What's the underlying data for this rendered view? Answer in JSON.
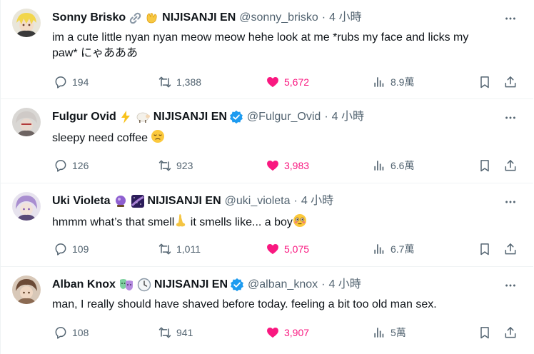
{
  "tweets": [
    {
      "name": "Sonny Brisko",
      "badge_icons": [
        "link-icon",
        "clap-hands-icon"
      ],
      "affiliation": "NIJISANJI EN",
      "handle": "@sonny_brisko",
      "time": "4 小時",
      "text_line1": "im a cute little nyan nyan meow meow hehe look at me *rubs my face and licks my",
      "text_line2": "paw*  にゃあああ",
      "replies": "194",
      "reposts": "1,388",
      "likes": "5,672",
      "views": "8.9萬",
      "verified": false
    },
    {
      "name": "Fulgur Ovid",
      "badge_icons": [
        "lightning-icon",
        "sheep-icon"
      ],
      "affiliation": "NIJISANJI EN",
      "handle": "@Fulgur_Ovid",
      "time": "4 小時",
      "text": "sleepy need coffee",
      "trailing_emoji": "pensive-face-icon",
      "replies": "126",
      "reposts": "923",
      "likes": "3,983",
      "views": "6.6萬",
      "verified": true
    },
    {
      "name": "Uki Violeta",
      "badge_icons": [
        "crystal-ball-icon",
        "milky-way-icon"
      ],
      "affiliation": "NIJISANJI EN",
      "handle": "@uki_violeta",
      "time": "4 小時",
      "text_a": "hmmm what’s that smell",
      "text_b": " it smells like... a boy",
      "inline_emojis": [
        "nose-icon",
        "flushed-face-icon"
      ],
      "replies": "109",
      "reposts": "1,011",
      "likes": "5,075",
      "views": "6.7萬",
      "verified": false
    },
    {
      "name": "Alban Knox",
      "badge_icons": [
        "theater-masks-icon",
        "clock-icon"
      ],
      "affiliation": "NIJISANJI EN",
      "handle": "@alban_knox",
      "time": "4 小時",
      "text": "man, I really should have shaved before today. feeling a bit too old man sex.",
      "replies": "108",
      "reposts": "941",
      "likes": "3,907",
      "views": "5萬",
      "verified": true
    }
  ],
  "separator": "·",
  "colors": {
    "text": "#0f1419",
    "secondary": "#536471",
    "like": "#f91880",
    "verified": "#1d9bf0",
    "divider": "#eff3f4"
  }
}
